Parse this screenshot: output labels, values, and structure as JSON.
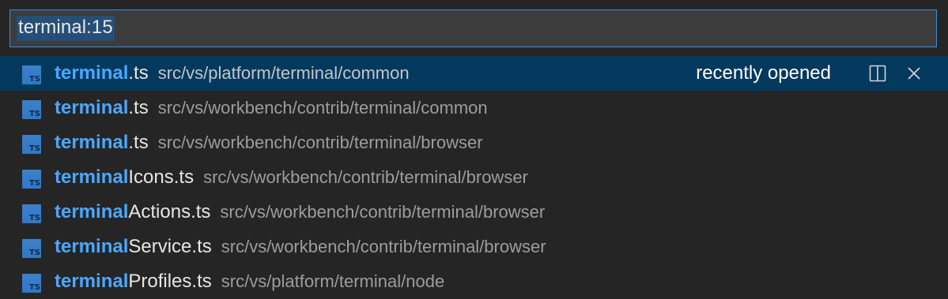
{
  "search": {
    "value": "terminal:15"
  },
  "results": [
    {
      "highlight": "terminal",
      "rest": ".ts",
      "path": "src/vs/platform/terminal/common",
      "selected": true
    },
    {
      "highlight": "terminal",
      "rest": ".ts",
      "path": "src/vs/workbench/contrib/terminal/common"
    },
    {
      "highlight": "terminal",
      "rest": ".ts",
      "path": "src/vs/workbench/contrib/terminal/browser"
    },
    {
      "highlight": "terminal",
      "rest": "Icons.ts",
      "path": "src/vs/workbench/contrib/terminal/browser"
    },
    {
      "highlight": "terminal",
      "rest": "Actions.ts",
      "path": "src/vs/workbench/contrib/terminal/browser"
    },
    {
      "highlight": "terminal",
      "rest": "Service.ts",
      "path": "src/vs/workbench/contrib/terminal/browser"
    },
    {
      "highlight": "terminal",
      "rest": "Profiles.ts",
      "path": "src/vs/platform/terminal/node"
    }
  ],
  "selected_row": {
    "badge": "recently opened",
    "actions": [
      {
        "icon": "split-editor-icon"
      },
      {
        "icon": "close-icon"
      }
    ]
  },
  "file_icon": {
    "label": "TS",
    "color": "#3178c6"
  },
  "colors": {
    "accent_border": "#3b8ddb",
    "highlight_text": "#4aa8ff",
    "selected_row_bg": "#04395e",
    "background": "#252526"
  }
}
